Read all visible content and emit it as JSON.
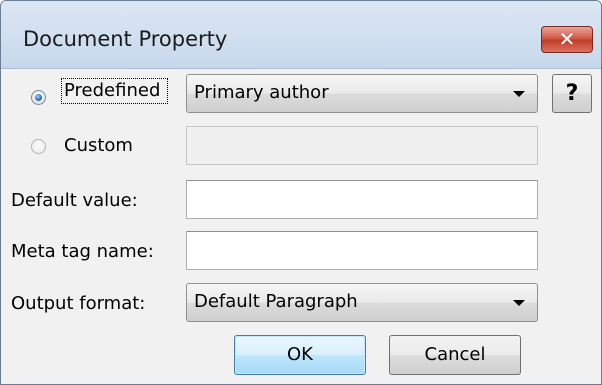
{
  "window": {
    "title": "Document Property",
    "close_glyph": "✕"
  },
  "source": {
    "predefined_label": "Predefined",
    "predefined_checked": true,
    "predefined_value": "Primary author",
    "custom_label": "Custom",
    "custom_checked": false,
    "custom_value": "",
    "help_glyph": "?"
  },
  "fields": {
    "default_value_label": "Default value:",
    "default_value": "",
    "meta_tag_label": "Meta tag name:",
    "meta_tag_value": "",
    "output_format_label": "Output format:",
    "output_format_value": "Default Paragraph"
  },
  "buttons": {
    "ok": "OK",
    "cancel": "Cancel"
  },
  "icons": {
    "close": "close-icon",
    "help": "help-icon",
    "dropdown": "chevron-down-icon"
  },
  "colors": {
    "close_button": "#c8432f",
    "default_button": "#bee6fd",
    "titlebar": "#c7d8ec"
  }
}
